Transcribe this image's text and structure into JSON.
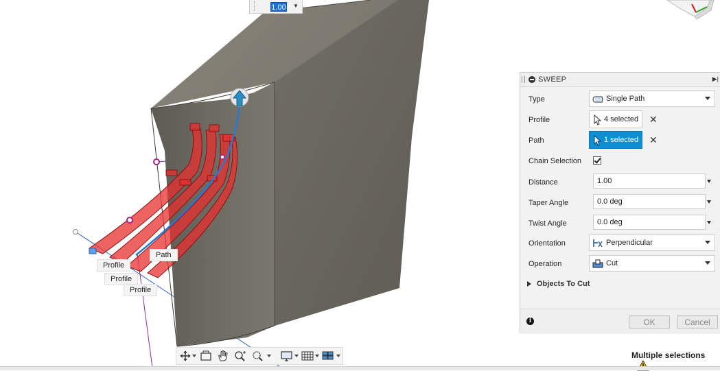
{
  "viewport": {
    "distance_input": "1.00",
    "labels": {
      "profile_1": "Profile",
      "profile_2": "Profile",
      "profile_3": "Profile",
      "path": "Path"
    }
  },
  "panel": {
    "title": "SWEEP",
    "type": {
      "label": "Type",
      "value": "Single Path",
      "icon": "single-path-icon"
    },
    "profile": {
      "label": "Profile",
      "value": "4 selected"
    },
    "path": {
      "label": "Path",
      "value": "1 selected"
    },
    "chain_selection": {
      "label": "Chain Selection",
      "checked": true
    },
    "distance": {
      "label": "Distance",
      "value": "1.00"
    },
    "taper_angle": {
      "label": "Taper Angle",
      "value": "0.0 deg"
    },
    "twist_angle": {
      "label": "Twist Angle",
      "value": "0.0 deg"
    },
    "orientation": {
      "label": "Orientation",
      "value": "Perpendicular",
      "icon": "perpendicular-icon"
    },
    "operation": {
      "label": "Operation",
      "value": "Cut",
      "icon": "cut-icon"
    },
    "objects_to_cut": "Objects To Cut",
    "ok": "OK",
    "cancel": "Cancel"
  },
  "status": {
    "text": "Multiple selections",
    "icon": "warning-icon",
    "warning_color": "#f2c200"
  },
  "colors": {
    "body": "#6b6860",
    "selection_red": "#e8302d",
    "path_blue": "#2a78d6",
    "active_button": "#0e8ed3"
  }
}
